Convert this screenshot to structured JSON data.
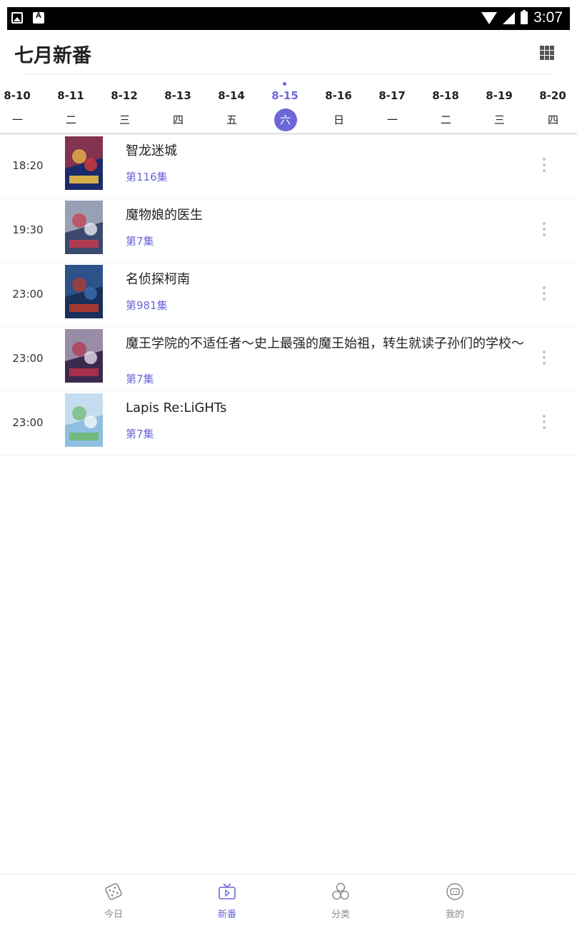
{
  "status_bar": {
    "time": "3:07",
    "left_icons": [
      "image-notification-icon",
      "a-notification-icon"
    ],
    "right_icons": [
      "wifi-icon",
      "cell-signal-icon",
      "battery-icon"
    ]
  },
  "header": {
    "title": "七月新番",
    "grid_icon": "grid-view-icon"
  },
  "dates": [
    {
      "date": "8-10",
      "day": "一"
    },
    {
      "date": "8-11",
      "day": "二"
    },
    {
      "date": "8-12",
      "day": "三"
    },
    {
      "date": "8-13",
      "day": "四"
    },
    {
      "date": "8-14",
      "day": "五"
    },
    {
      "date": "8-15",
      "day": "六",
      "selected": true
    },
    {
      "date": "8-16",
      "day": "日"
    },
    {
      "date": "8-17",
      "day": "一"
    },
    {
      "date": "8-18",
      "day": "二"
    },
    {
      "date": "8-19",
      "day": "三"
    },
    {
      "date": "8-20",
      "day": "四"
    }
  ],
  "shows": [
    {
      "time": "18:20",
      "title": "智龙迷城",
      "episode": "第116集"
    },
    {
      "time": "19:30",
      "title": "魔物娘的医生",
      "episode": "第7集"
    },
    {
      "time": "23:00",
      "title": "名侦探柯南",
      "episode": "第981集"
    },
    {
      "time": "23:00",
      "title": "魔王学院的不适任者～史上最强的魔王始祖，转生就读子孙们的学校～",
      "episode": "第7集"
    },
    {
      "time": "23:00",
      "title": "Lapis Re:LiGHTs",
      "episode": "第7集"
    }
  ],
  "bottom_nav": [
    {
      "label": "今日",
      "icon": "dice-icon"
    },
    {
      "label": "新番",
      "icon": "tv-icon",
      "active": true
    },
    {
      "label": "分类",
      "icon": "circles-icon"
    },
    {
      "label": "我的",
      "icon": "face-icon"
    }
  ],
  "colors": {
    "accent": "#6b67d8",
    "status_bar": "#000000",
    "text": "#222222",
    "muted": "#8a8a8a"
  }
}
